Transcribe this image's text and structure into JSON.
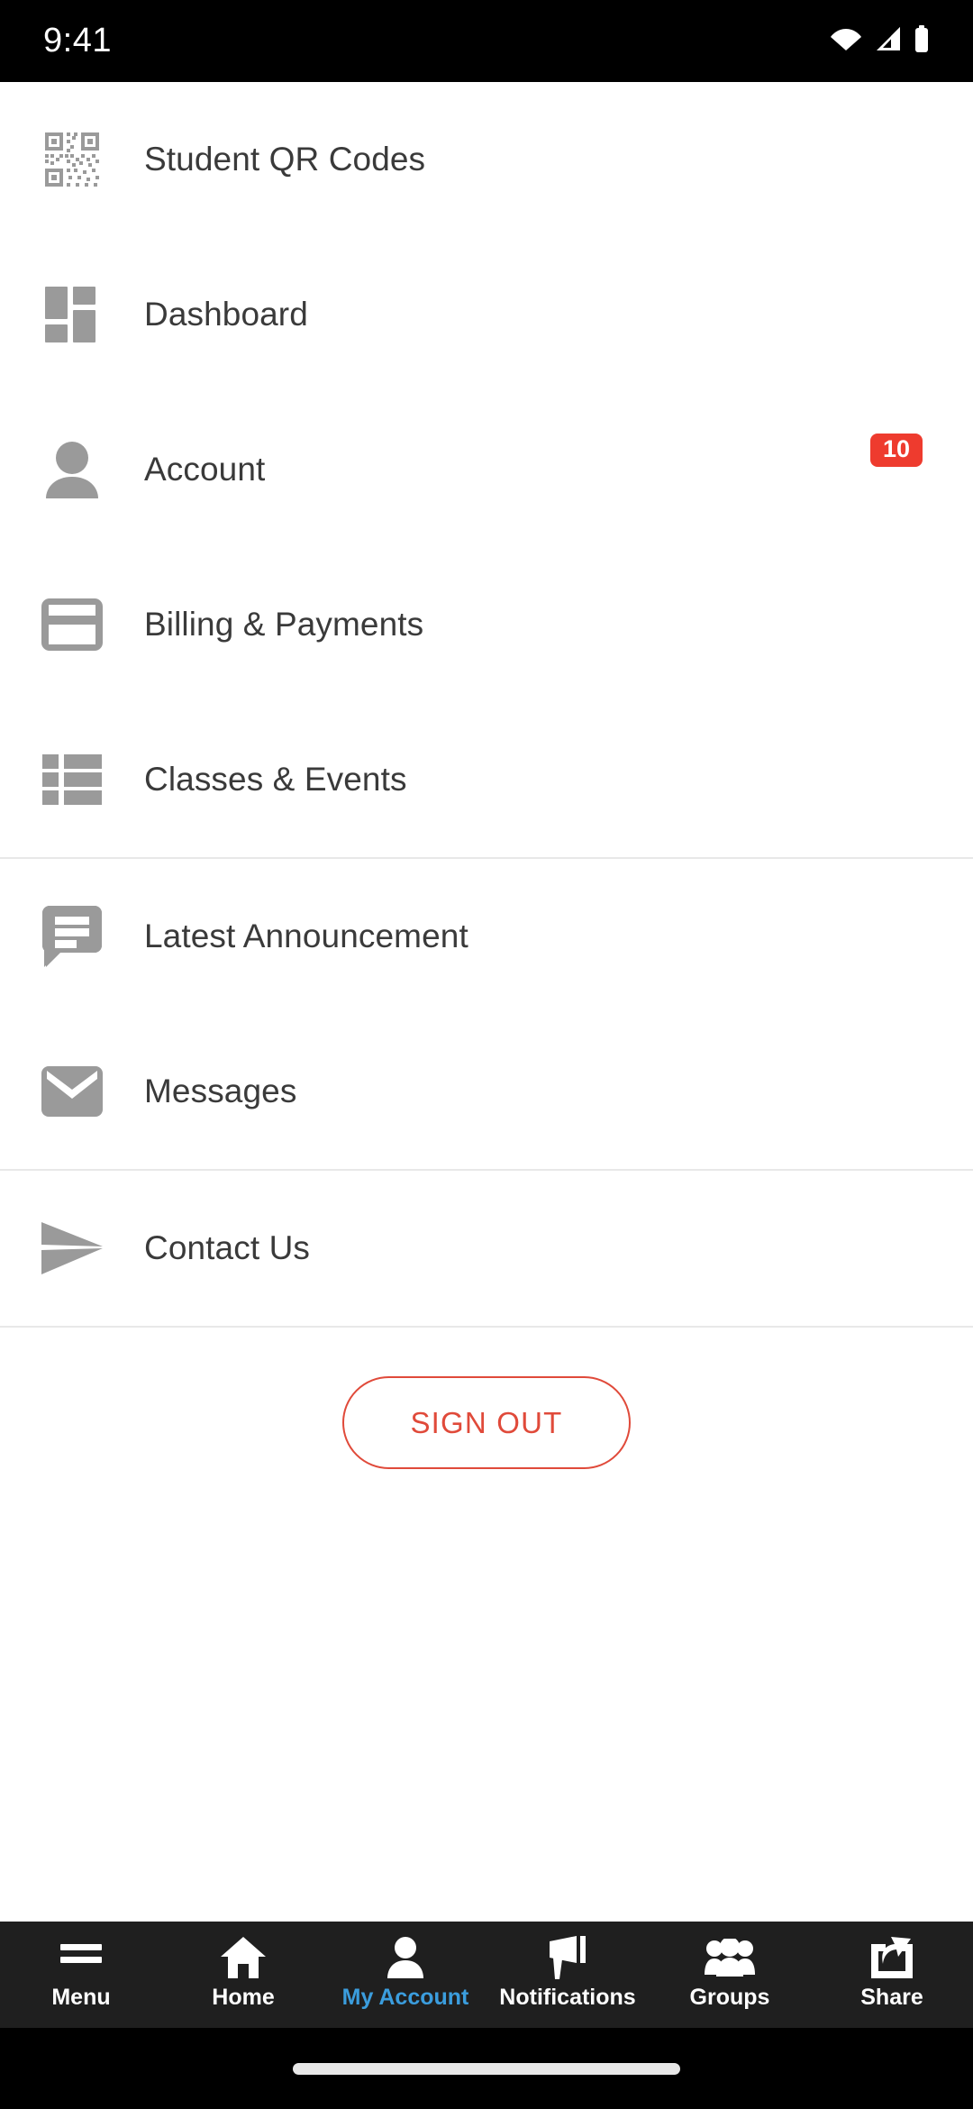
{
  "statusbar": {
    "time": "9:41",
    "icons": [
      "wifi-icon",
      "cellular-signal-icon",
      "battery-icon"
    ]
  },
  "menu": {
    "groups": [
      {
        "items": [
          {
            "label": "Student QR Codes",
            "icon": "qr-code-icon",
            "badge": null
          },
          {
            "label": "Dashboard",
            "icon": "dashboard-grid-icon",
            "badge": null
          },
          {
            "label": "Account",
            "icon": "person-icon",
            "badge": "10"
          },
          {
            "label": "Billing & Payments",
            "icon": "credit-card-icon",
            "badge": null
          },
          {
            "label": "Classes & Events",
            "icon": "list-icon",
            "badge": null
          }
        ]
      },
      {
        "items": [
          {
            "label": "Latest Announcement",
            "icon": "speech-bubble-icon",
            "badge": null
          },
          {
            "label": "Messages",
            "icon": "envelope-icon",
            "badge": null
          }
        ]
      },
      {
        "items": [
          {
            "label": "Contact Us",
            "icon": "paper-plane-icon",
            "badge": null
          }
        ]
      }
    ]
  },
  "signout": {
    "label": "SIGN OUT"
  },
  "bottomnav": {
    "items": [
      {
        "label": "Menu",
        "icon": "hamburger-icon",
        "active": false
      },
      {
        "label": "Home",
        "icon": "home-icon",
        "active": false
      },
      {
        "label": "My Account",
        "icon": "person-icon",
        "active": true
      },
      {
        "label": "Notifications",
        "icon": "megaphone-icon",
        "active": false
      },
      {
        "label": "Groups",
        "icon": "people-group-icon",
        "active": false
      },
      {
        "label": "Share",
        "icon": "share-icon",
        "active": false
      }
    ]
  },
  "colors": {
    "badge_red": "#ee3b2e",
    "signout_red": "#e04a3a",
    "active_blue": "#3b9ddd",
    "icon_gray": "#9a9a9a",
    "label_gray": "#3a3a3a",
    "nav_bg": "#1f1f1f"
  }
}
